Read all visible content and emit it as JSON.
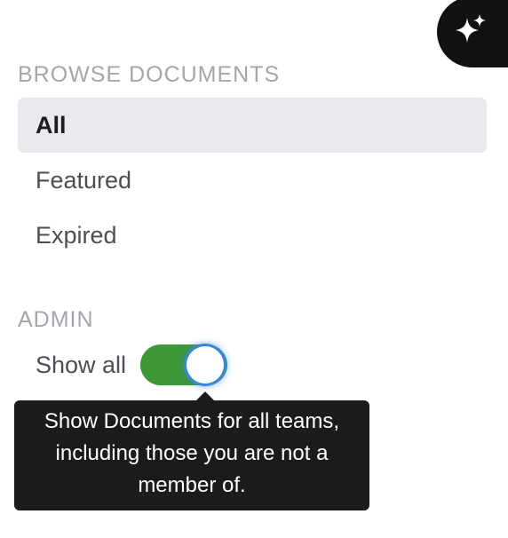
{
  "ai_button": {
    "icon": "sparkle-icon"
  },
  "browse": {
    "heading": "BROWSE DOCUMENTS",
    "items": [
      {
        "label": "All",
        "active": true
      },
      {
        "label": "Featured",
        "active": false
      },
      {
        "label": "Expired",
        "active": false
      }
    ]
  },
  "admin": {
    "heading": "ADMIN",
    "toggle_label": "Show all",
    "toggle_on": true,
    "tooltip": "Show Documents for all teams, including those you are not a member of."
  },
  "colors": {
    "toggle_on": "#3e9837",
    "focus_ring": "#3a86d8",
    "tooltip_bg": "#1b1b1c",
    "active_item_bg": "#e9eaed"
  }
}
